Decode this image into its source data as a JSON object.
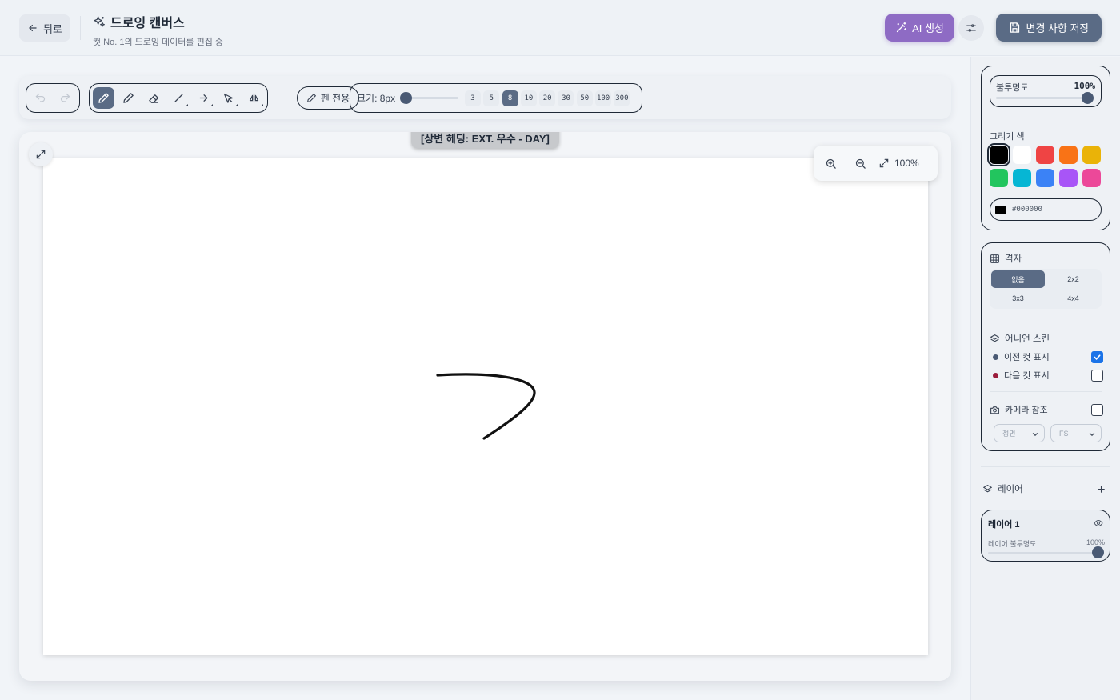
{
  "header": {
    "back_label": "뒤로",
    "title": "드로잉 캔버스",
    "subtitle": "컷 No. 1의 드로잉 데이터를 편집 중",
    "ai_label": "AI 생성",
    "save_label": "변경 사항 저장"
  },
  "toolbar": {
    "tools": [
      "undo-icon",
      "redo-icon",
      "brush-icon",
      "pencil-icon",
      "eraser-icon",
      "line-icon",
      "arrow-icon",
      "select-icon",
      "mirror-icon"
    ],
    "active_tool": "brush",
    "pen_only_label": "펜 전용",
    "size_label": "크기: 8px",
    "size_presets": [
      "3",
      "5",
      "8",
      "10",
      "20",
      "30",
      "50",
      "100",
      "300"
    ],
    "active_size": "8"
  },
  "canvas": {
    "scene_label": "[상변 헤딩: EXT. 우수 - DAY]",
    "zoom_label": "100%"
  },
  "panel": {
    "opacity": {
      "label": "불투명도",
      "value": "100%"
    },
    "color": {
      "label": "그리기 색",
      "swatches": [
        "#000000",
        "#ffffff",
        "#ef4444",
        "#f97316",
        "#eab308",
        "#22c55e",
        "#06b6d4",
        "#3b82f6",
        "#a855f7",
        "#ec4899"
      ],
      "selected": "#000000",
      "hex_value": "#000000"
    },
    "grid": {
      "title": "격자",
      "options": [
        "없음",
        "2x2",
        "3x3",
        "4x4"
      ],
      "selected": "없음"
    },
    "onion": {
      "title": "어니언 스킨",
      "prev_label": "이전 컷 표시",
      "prev_checked": true,
      "prev_color": "#4a5a74",
      "next_label": "다음 컷 표시",
      "next_checked": false,
      "next_color": "#9b1c3c"
    },
    "camera": {
      "title": "카메라 참조",
      "checked": false,
      "angle_value": "정면",
      "shot_value": "FS"
    },
    "layers": {
      "title": "레이어",
      "items": [
        {
          "name": "레이어 1",
          "opacity_label": "레이어 불투명도",
          "opacity_value": "100%"
        }
      ]
    }
  }
}
